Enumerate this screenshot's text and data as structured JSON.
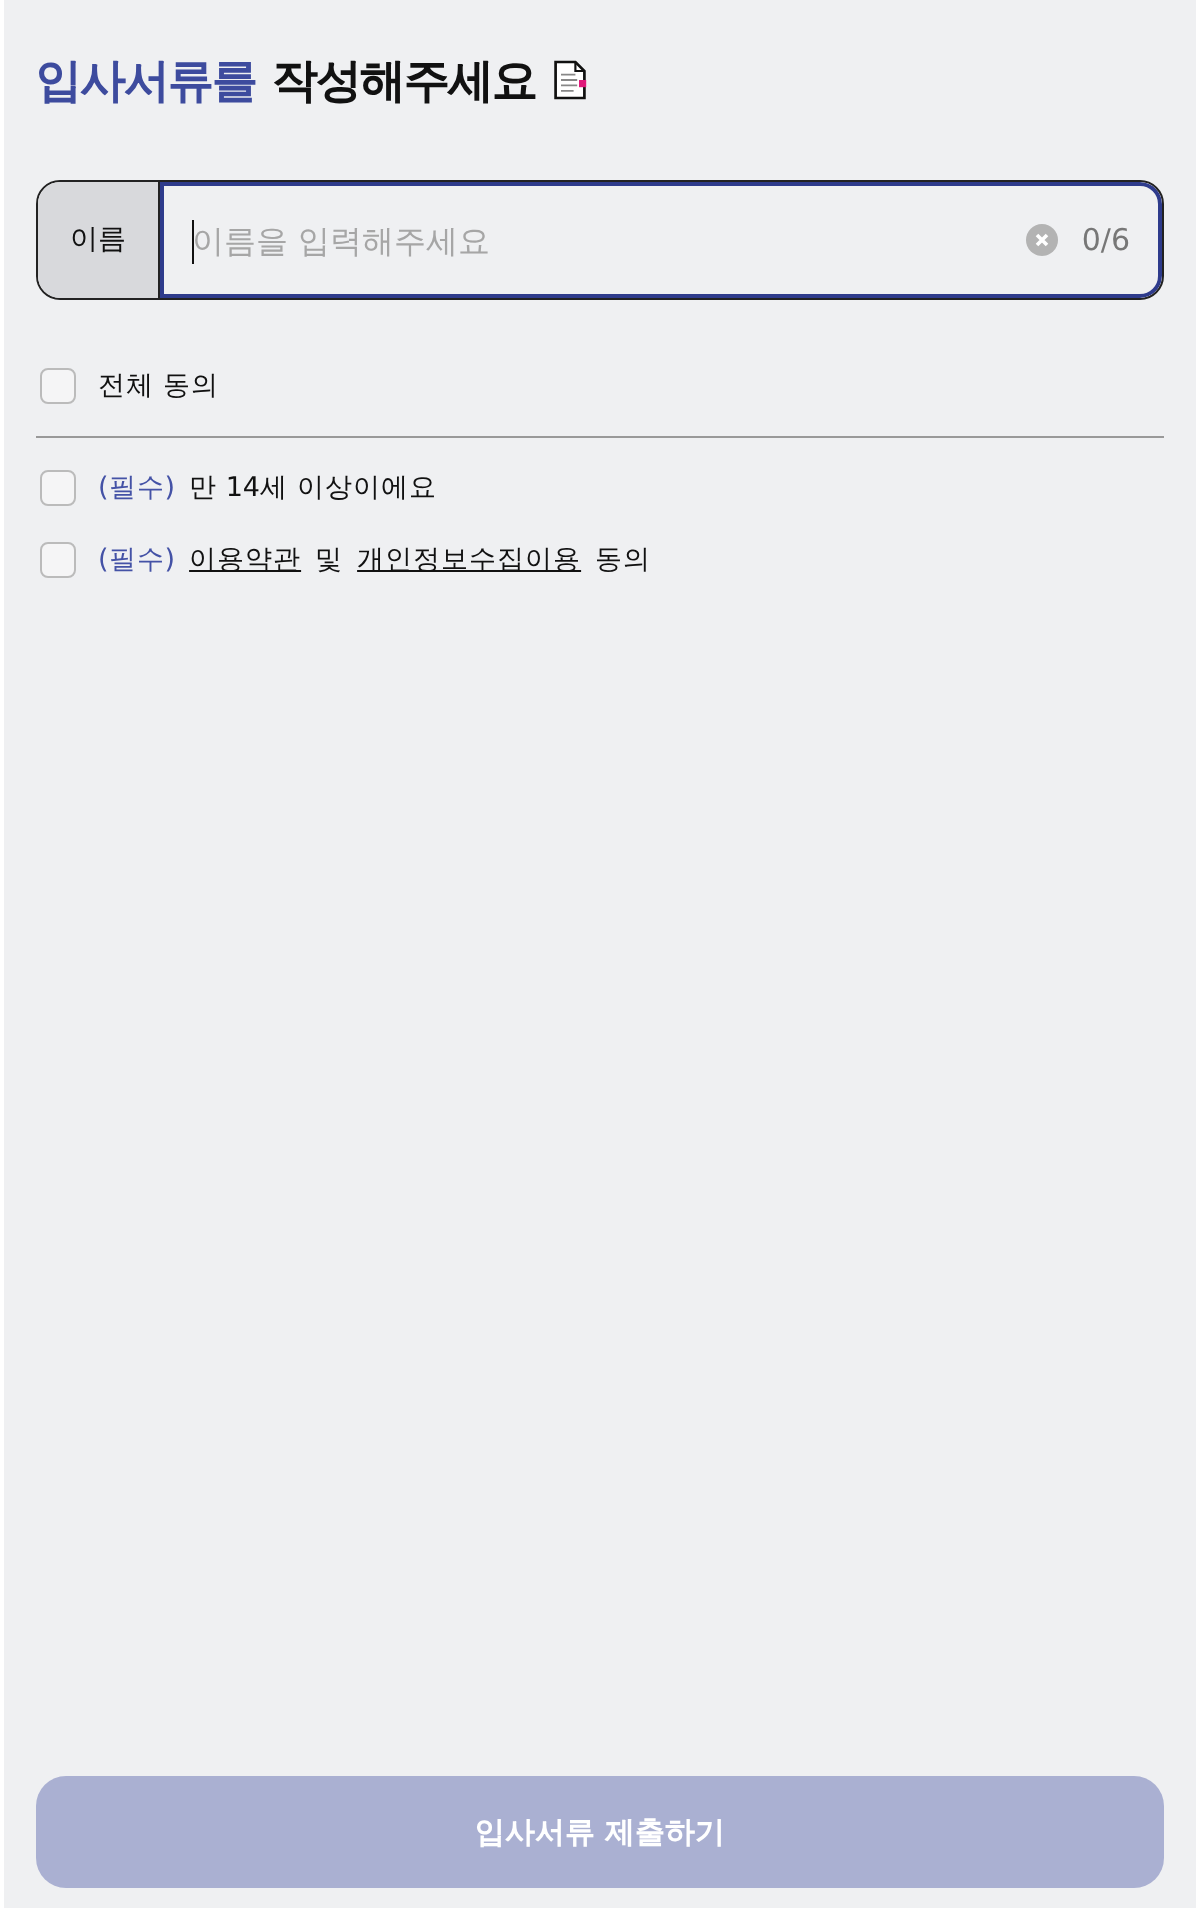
{
  "title": {
    "highlight": "입사서류를",
    "rest": "작성해주세요"
  },
  "name_field": {
    "label": "이름",
    "placeholder": "이름을 입력해주세요",
    "counter": "0/6",
    "focused": true
  },
  "agree_all": {
    "label": "전체 동의",
    "checked": false
  },
  "agreements": [
    {
      "tag": "(필수)",
      "checked": false,
      "parts": [
        {
          "text": "만 14세 이상이에요",
          "link": false
        }
      ]
    },
    {
      "tag": "(필수)",
      "checked": false,
      "parts": [
        {
          "text": "이용약관",
          "link": true
        },
        {
          "text": "및",
          "link": false
        },
        {
          "text": "개인정보수집이용",
          "link": true
        },
        {
          "text": "동의",
          "link": false
        }
      ]
    }
  ],
  "submit": {
    "label": "입사서류 제출하기",
    "disabled": true
  }
}
